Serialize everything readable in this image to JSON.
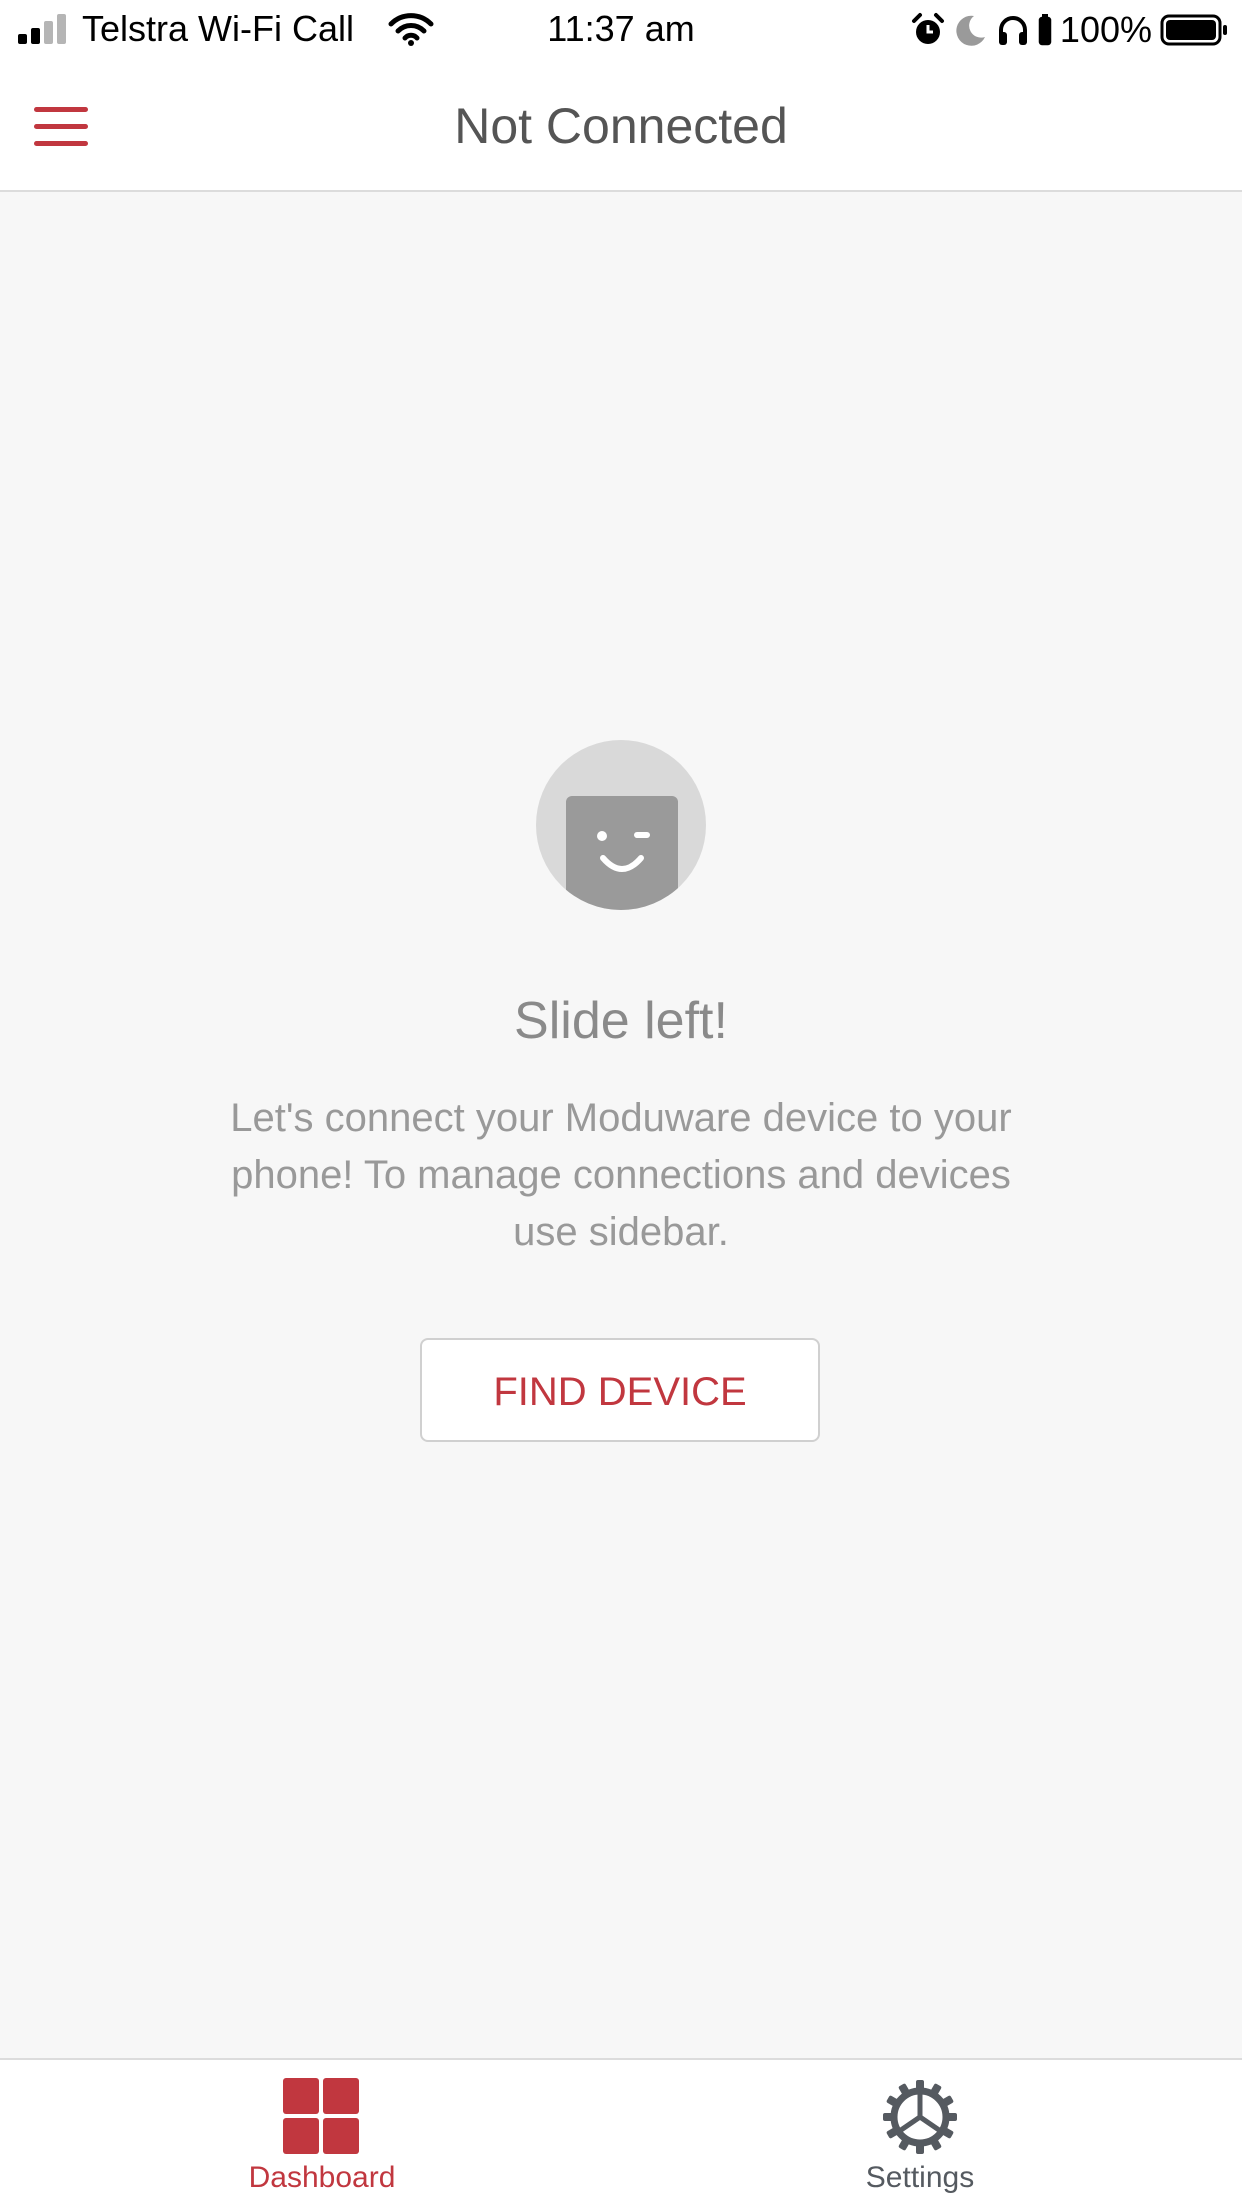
{
  "status_bar": {
    "carrier": "Telstra Wi-Fi Call",
    "time": "11:37 am",
    "battery": "100%"
  },
  "header": {
    "title": "Not Connected"
  },
  "content": {
    "title": "Slide left!",
    "instructions": "Let's connect your Moduware device to your phone! To manage connections and devices use sidebar.",
    "find_button_label": "FIND DEVICE"
  },
  "tabs": [
    {
      "label": "Dashboard",
      "icon": "grid-icon",
      "active": true
    },
    {
      "label": "Settings",
      "icon": "gear-icon",
      "active": false
    }
  ],
  "colors": {
    "accent": "#c1373f",
    "background": "#f7f7f7",
    "inactive_tab": "#555a60"
  }
}
